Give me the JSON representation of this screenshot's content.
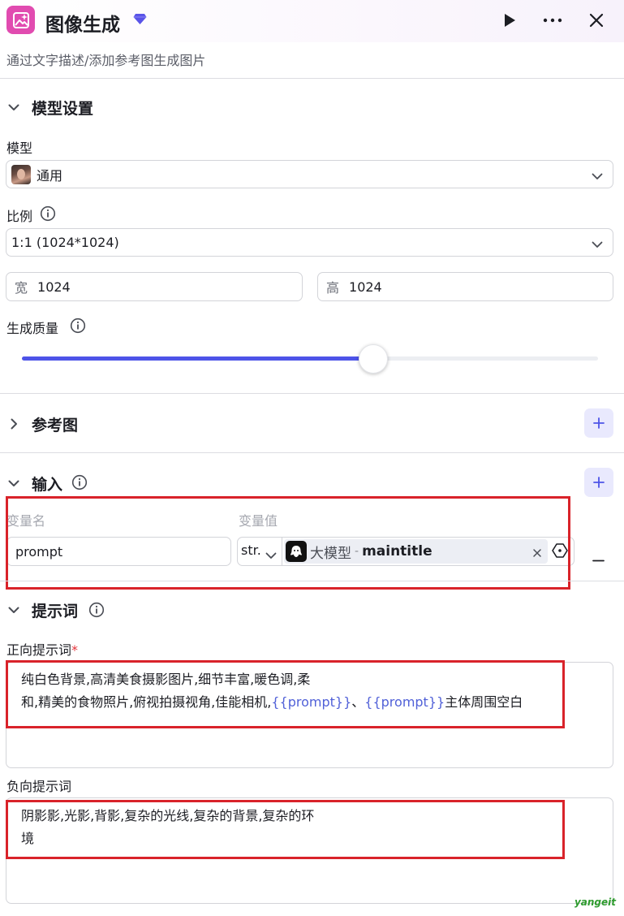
{
  "header": {
    "title": "图像生成",
    "subtitle": "通过文字描述/添加参考图生成图片",
    "brand_color": "#e14bb0",
    "accent": "#4d53e8"
  },
  "model_settings": {
    "title": "模型设置",
    "model_label": "模型",
    "model_value": "通用",
    "ratio_label": "比例",
    "ratio_value": "1:1 (1024*1024)",
    "width_prefix": "宽",
    "width_value": "1024",
    "height_prefix": "高",
    "height_value": "1024",
    "quality_label": "生成质量",
    "quality_fraction": 0.61
  },
  "reference": {
    "title": "参考图"
  },
  "inputs": {
    "title": "输入",
    "col_name": "变量名",
    "col_value": "变量值",
    "rows": [
      {
        "name": "prompt",
        "type": "str.",
        "source_node": "大模型",
        "separator": "-",
        "source_field": "maintitle"
      }
    ]
  },
  "prompts": {
    "title": "提示词",
    "positive_label": "正向提示词",
    "required_mark": "*",
    "positive_line1": "纯白色背景,高清美食摄影图片,细节丰富,暖色调,柔",
    "positive_line2_a": "和,精美的食物照片,俯视拍摄视角,佳能相机,",
    "positive_var1": "{{prompt}}",
    "positive_sep": "、",
    "positive_var2": "{{prompt}}",
    "positive_line2_b": "主体周围空白",
    "negative_label": "负向提示词",
    "negative_line1": "阴影影,光影,背影,复杂的光线,复杂的背景,复杂的环",
    "negative_line2": "境"
  },
  "watermark": "yangeit"
}
